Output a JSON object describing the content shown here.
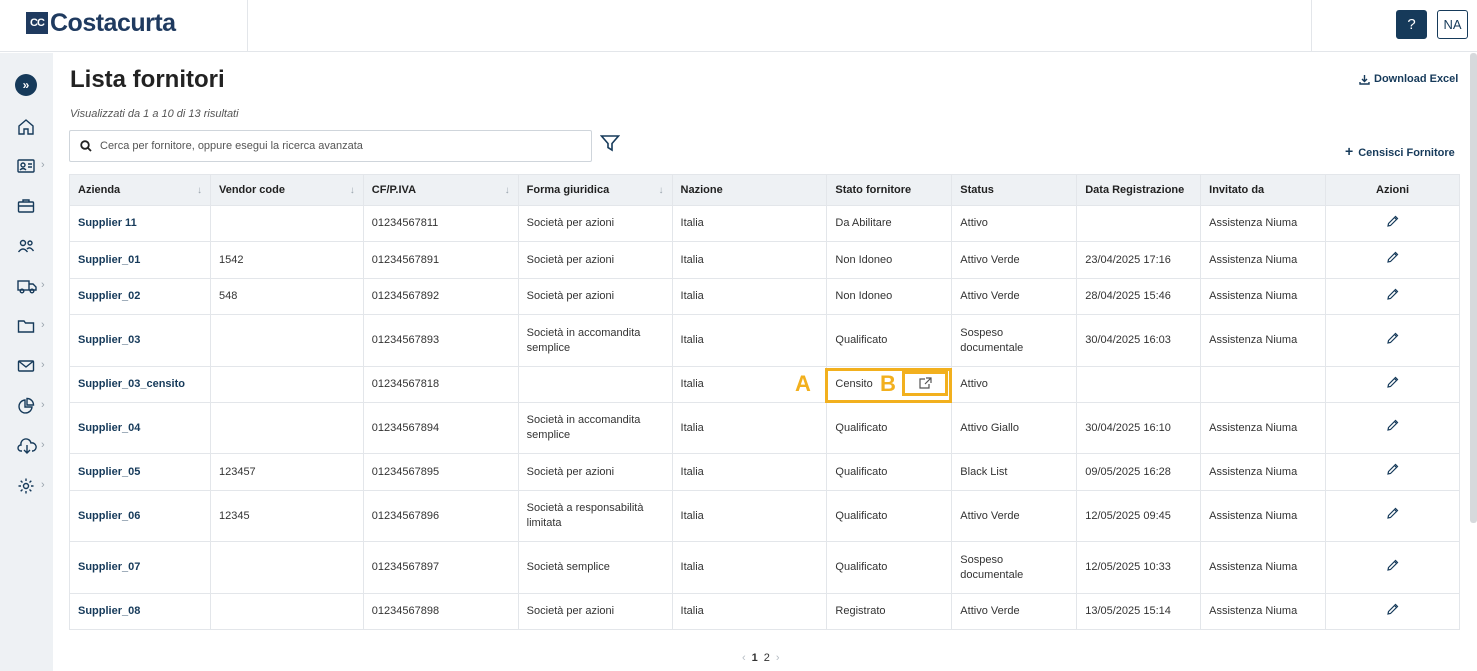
{
  "header": {
    "logo_mark": "CC",
    "logo_text": "Costacurta",
    "help_label": "?",
    "user_initials": "NA"
  },
  "sidebar": {
    "items": [
      {
        "icon": "home-icon",
        "has_submenu": false
      },
      {
        "icon": "id-card-icon",
        "has_submenu": true
      },
      {
        "icon": "briefcase-icon",
        "has_submenu": false
      },
      {
        "icon": "users-icon",
        "has_submenu": false
      },
      {
        "icon": "truck-icon",
        "has_submenu": true
      },
      {
        "icon": "folder-icon",
        "has_submenu": true
      },
      {
        "icon": "mail-icon",
        "has_submenu": true
      },
      {
        "icon": "pie-chart-icon",
        "has_submenu": true
      },
      {
        "icon": "cloud-download-icon",
        "has_submenu": true
      },
      {
        "icon": "gear-icon",
        "has_submenu": true
      }
    ]
  },
  "main": {
    "title": "Lista fornitori",
    "results_text": "Visualizzati da 1 a 10 di 13 risultati",
    "download_label": "Download Excel",
    "search_placeholder": "Cerca per fornitore, oppure esegui la ricerca avanzata",
    "censisci_label": "Censisci Fornitore"
  },
  "table": {
    "columns": [
      "Azienda",
      "Vendor code",
      "CF/P.IVA",
      "Forma giuridica",
      "Nazione",
      "Stato fornitore",
      "Status",
      "Data Registrazione",
      "Invitato da",
      "Azioni"
    ],
    "rows": [
      [
        "Supplier 11",
        "",
        "01234567811",
        "Società per azioni",
        "Italia",
        "Da Abilitare",
        "Attivo",
        "",
        "Assistenza Niuma"
      ],
      [
        "Supplier_01",
        "1542",
        "01234567891",
        "Società per azioni",
        "Italia",
        "Non Idoneo",
        "Attivo Verde",
        "23/04/2025 17:16",
        "Assistenza Niuma"
      ],
      [
        "Supplier_02",
        "548",
        "01234567892",
        "Società per azioni",
        "Italia",
        "Non Idoneo",
        "Attivo Verde",
        "28/04/2025 15:46",
        "Assistenza Niuma"
      ],
      [
        "Supplier_03",
        "",
        "01234567893",
        "Società in accomandita semplice",
        "Italia",
        "Qualificato",
        "Sospeso documentale",
        "30/04/2025 16:03",
        "Assistenza Niuma"
      ],
      [
        "Supplier_03_censito",
        "",
        "01234567818",
        "",
        "Italia",
        "Censito",
        "Attivo",
        "",
        ""
      ],
      [
        "Supplier_04",
        "",
        "01234567894",
        "Società in accomandita semplice",
        "Italia",
        "Qualificato",
        "Attivo Giallo",
        "30/04/2025 16:10",
        "Assistenza Niuma"
      ],
      [
        "Supplier_05",
        "123457",
        "01234567895",
        "Società per azioni",
        "Italia",
        "Qualificato",
        "Black List",
        "09/05/2025 16:28",
        "Assistenza Niuma"
      ],
      [
        "Supplier_06",
        "12345",
        "01234567896",
        "Società a responsabilità limitata",
        "Italia",
        "Qualificato",
        "Attivo Verde",
        "12/05/2025 09:45",
        "Assistenza Niuma"
      ],
      [
        "Supplier_07",
        "",
        "01234567897",
        "Società semplice",
        "Italia",
        "Qualificato",
        "Sospeso documentale",
        "12/05/2025 10:33",
        "Assistenza Niuma"
      ],
      [
        "Supplier_08",
        "",
        "01234567898",
        "Società per azioni",
        "Italia",
        "Registrato",
        "Attivo Verde",
        "13/05/2025 15:14",
        "Assistenza Niuma"
      ]
    ]
  },
  "annotations": {
    "a": "A",
    "b": "B",
    "color": "#f2b01e"
  },
  "pagination": {
    "prev": "‹",
    "pages": [
      "1",
      "2"
    ],
    "next": "›"
  }
}
